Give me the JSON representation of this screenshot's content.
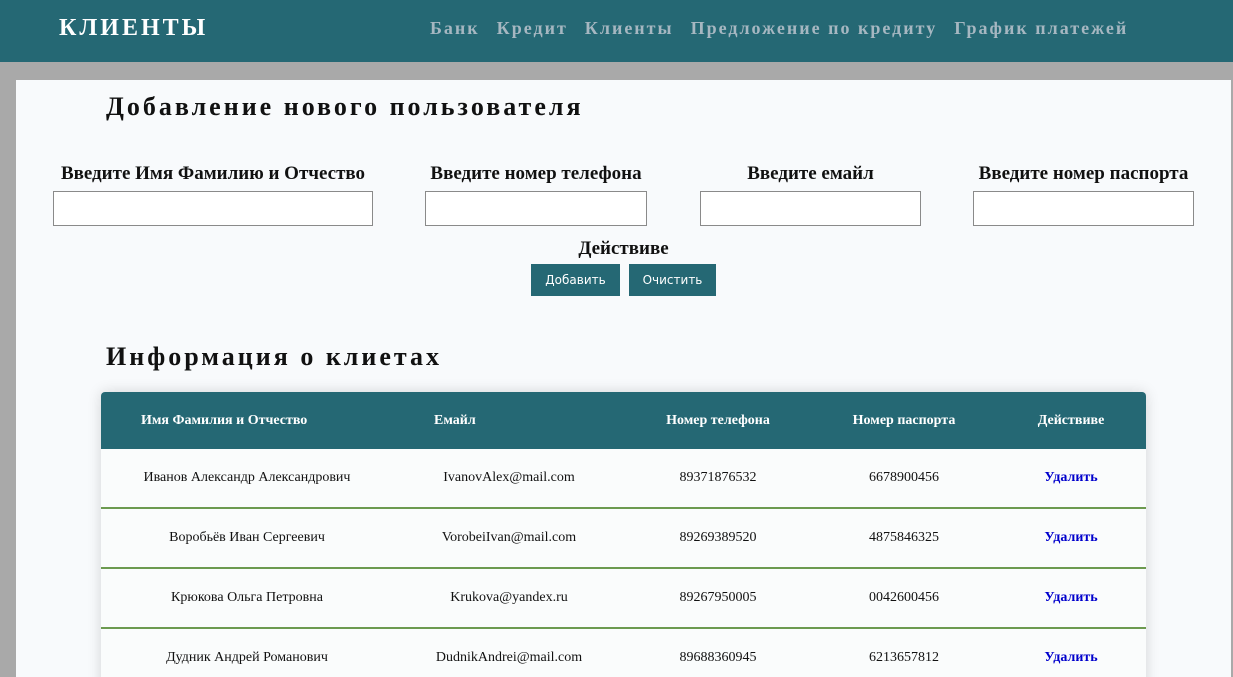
{
  "header": {
    "brand": "КЛИЕНТЫ",
    "nav": [
      "Банк",
      "Кредит",
      "Клиенты",
      "Предложение по кредиту",
      "График платежей"
    ]
  },
  "form": {
    "title": "Добавление нового пользователя",
    "fields": [
      {
        "label": "Введите Имя Фамилию и Отчество",
        "value": ""
      },
      {
        "label": "Введите номер телефона",
        "value": ""
      },
      {
        "label": "Введите емайл",
        "value": ""
      },
      {
        "label": "Введите номер паспорта",
        "value": ""
      }
    ],
    "action_label": "Действиве",
    "add_button": "Добавить",
    "clear_button": "Очистить"
  },
  "table": {
    "title": "Информация о клиетах",
    "columns": [
      "Имя Фамилия и Отчество",
      "Емайл",
      "Номер телефона",
      "Номер паспорта",
      "Действиве"
    ],
    "rows": [
      {
        "name": "Иванов Александр Александрович",
        "email": "IvanovAlex@mail.com",
        "phone": "89371876532",
        "passport": "6678900456",
        "action": "Удалить"
      },
      {
        "name": "Воробьёв Иван Сергеевич",
        "email": "VorobeiIvan@mail.com",
        "phone": "89269389520",
        "passport": "4875846325",
        "action": "Удалить"
      },
      {
        "name": "Крюкова Ольга Петровна",
        "email": "Krukova@yandex.ru",
        "phone": "89267950005",
        "passport": "0042600456",
        "action": "Удалить"
      },
      {
        "name": "Дудник Андрей Романович",
        "email": "DudnikAndrei@mail.com",
        "phone": "89688360945",
        "passport": "6213657812",
        "action": "Удалить"
      }
    ]
  },
  "colors": {
    "accent": "#256874",
    "row_border": "#6c9a50",
    "link": "#0000cc"
  }
}
